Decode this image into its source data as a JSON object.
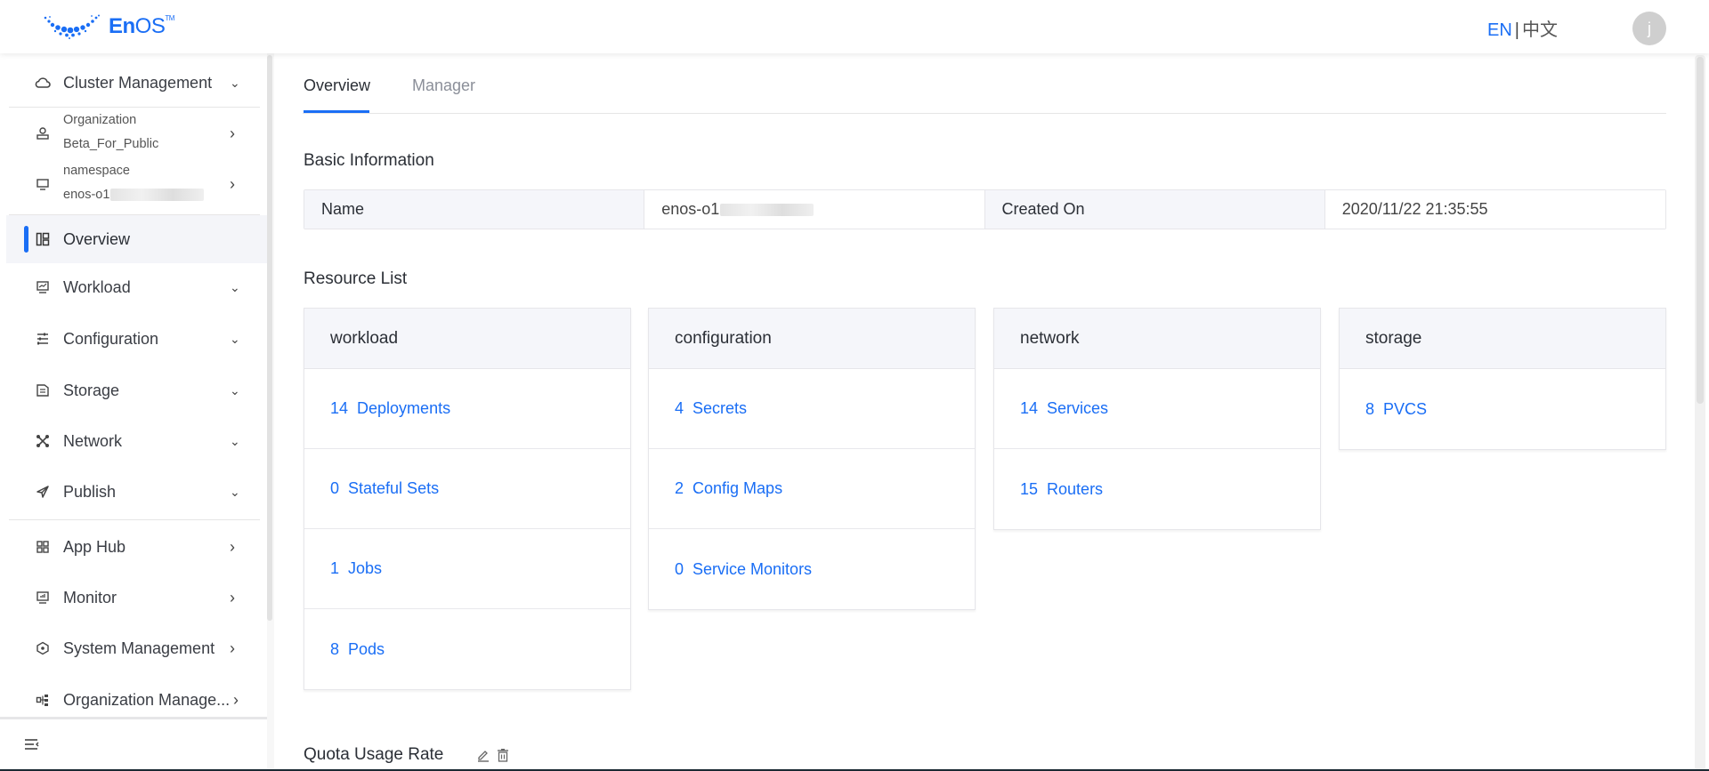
{
  "header": {
    "logo_text_bold": "En",
    "logo_text_rest": "OS",
    "logo_tm": "TM",
    "lang_en": "EN",
    "lang_sep": "|",
    "lang_zh": "中文",
    "avatar_initial": "j"
  },
  "sidebar": {
    "cluster": {
      "label": "Cluster Management",
      "icon": "cloud-icon"
    },
    "organization": {
      "title": "Organization",
      "value": "Beta_For_Public",
      "icon": "org-user-icon"
    },
    "namespace": {
      "title": "namespace",
      "value": "enos-o1",
      "icon": "monitor-icon"
    },
    "items": [
      {
        "label": "Overview",
        "icon": "layout-icon",
        "active": true
      },
      {
        "label": "Workload",
        "icon": "chart-screen-icon",
        "expand": "down"
      },
      {
        "label": "Configuration",
        "icon": "sliders-icon",
        "expand": "down"
      },
      {
        "label": "Storage",
        "icon": "storage-icon",
        "expand": "down"
      },
      {
        "label": "Network",
        "icon": "network-icon",
        "expand": "down"
      },
      {
        "label": "Publish",
        "icon": "send-icon",
        "expand": "down"
      },
      {
        "label": "App Hub",
        "icon": "apps-icon",
        "expand": "right"
      },
      {
        "label": "Monitor",
        "icon": "monitor-chart-icon",
        "expand": "right"
      },
      {
        "label": "System Management",
        "icon": "hexagon-icon",
        "expand": "right"
      },
      {
        "label": "Organization Manage...",
        "icon": "org-tree-icon",
        "expand": "right"
      }
    ],
    "collapse_icon": "collapse-menu-icon"
  },
  "tabs": [
    {
      "label": "Overview",
      "active": true
    },
    {
      "label": "Manager",
      "active": false
    }
  ],
  "basic_info": {
    "title": "Basic Information",
    "name_label": "Name",
    "name_value": "enos-o1",
    "created_label": "Created On",
    "created_value": "2020/11/22 21:35:55"
  },
  "resource_list": {
    "title": "Resource List",
    "cards": [
      {
        "title": "workload",
        "rows": [
          {
            "count": "14",
            "label": "Deployments"
          },
          {
            "count": "0",
            "label": "Stateful Sets"
          },
          {
            "count": "1",
            "label": "Jobs"
          },
          {
            "count": "8",
            "label": "Pods"
          }
        ]
      },
      {
        "title": "configuration",
        "rows": [
          {
            "count": "4",
            "label": "Secrets"
          },
          {
            "count": "2",
            "label": "Config Maps"
          },
          {
            "count": "0",
            "label": "Service Monitors"
          }
        ]
      },
      {
        "title": "network",
        "rows": [
          {
            "count": "14",
            "label": "Services"
          },
          {
            "count": "15",
            "label": "Routers"
          }
        ]
      },
      {
        "title": "storage",
        "rows": [
          {
            "count": "8",
            "label": "PVCS"
          }
        ]
      }
    ]
  },
  "quota": {
    "title": "Quota Usage Rate"
  },
  "colors": {
    "accent": "#1a6ef5",
    "header_bg": "#f5f6fa",
    "active_bg": "#f4f5f9"
  }
}
